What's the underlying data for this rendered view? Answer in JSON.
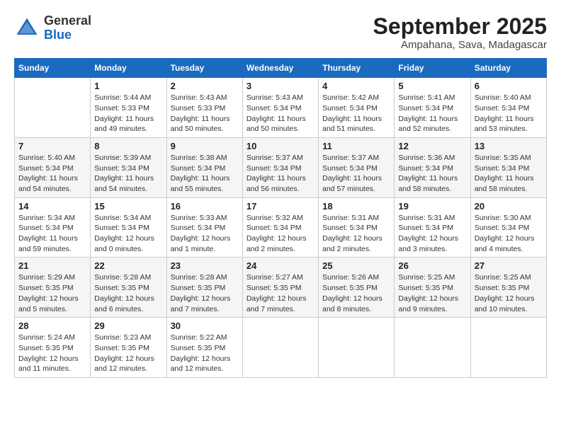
{
  "logo": {
    "general": "General",
    "blue": "Blue"
  },
  "title": "September 2025",
  "subtitle": "Ampahana, Sava, Madagascar",
  "days_of_week": [
    "Sunday",
    "Monday",
    "Tuesday",
    "Wednesday",
    "Thursday",
    "Friday",
    "Saturday"
  ],
  "weeks": [
    [
      {
        "day": "",
        "info": ""
      },
      {
        "day": "1",
        "info": "Sunrise: 5:44 AM\nSunset: 5:33 PM\nDaylight: 11 hours\nand 49 minutes."
      },
      {
        "day": "2",
        "info": "Sunrise: 5:43 AM\nSunset: 5:33 PM\nDaylight: 11 hours\nand 50 minutes."
      },
      {
        "day": "3",
        "info": "Sunrise: 5:43 AM\nSunset: 5:34 PM\nDaylight: 11 hours\nand 50 minutes."
      },
      {
        "day": "4",
        "info": "Sunrise: 5:42 AM\nSunset: 5:34 PM\nDaylight: 11 hours\nand 51 minutes."
      },
      {
        "day": "5",
        "info": "Sunrise: 5:41 AM\nSunset: 5:34 PM\nDaylight: 11 hours\nand 52 minutes."
      },
      {
        "day": "6",
        "info": "Sunrise: 5:40 AM\nSunset: 5:34 PM\nDaylight: 11 hours\nand 53 minutes."
      }
    ],
    [
      {
        "day": "7",
        "info": "Sunrise: 5:40 AM\nSunset: 5:34 PM\nDaylight: 11 hours\nand 54 minutes."
      },
      {
        "day": "8",
        "info": "Sunrise: 5:39 AM\nSunset: 5:34 PM\nDaylight: 11 hours\nand 54 minutes."
      },
      {
        "day": "9",
        "info": "Sunrise: 5:38 AM\nSunset: 5:34 PM\nDaylight: 11 hours\nand 55 minutes."
      },
      {
        "day": "10",
        "info": "Sunrise: 5:37 AM\nSunset: 5:34 PM\nDaylight: 11 hours\nand 56 minutes."
      },
      {
        "day": "11",
        "info": "Sunrise: 5:37 AM\nSunset: 5:34 PM\nDaylight: 11 hours\nand 57 minutes."
      },
      {
        "day": "12",
        "info": "Sunrise: 5:36 AM\nSunset: 5:34 PM\nDaylight: 11 hours\nand 58 minutes."
      },
      {
        "day": "13",
        "info": "Sunrise: 5:35 AM\nSunset: 5:34 PM\nDaylight: 11 hours\nand 58 minutes."
      }
    ],
    [
      {
        "day": "14",
        "info": "Sunrise: 5:34 AM\nSunset: 5:34 PM\nDaylight: 11 hours\nand 59 minutes."
      },
      {
        "day": "15",
        "info": "Sunrise: 5:34 AM\nSunset: 5:34 PM\nDaylight: 12 hours\nand 0 minutes."
      },
      {
        "day": "16",
        "info": "Sunrise: 5:33 AM\nSunset: 5:34 PM\nDaylight: 12 hours\nand 1 minute."
      },
      {
        "day": "17",
        "info": "Sunrise: 5:32 AM\nSunset: 5:34 PM\nDaylight: 12 hours\nand 2 minutes."
      },
      {
        "day": "18",
        "info": "Sunrise: 5:31 AM\nSunset: 5:34 PM\nDaylight: 12 hours\nand 2 minutes."
      },
      {
        "day": "19",
        "info": "Sunrise: 5:31 AM\nSunset: 5:34 PM\nDaylight: 12 hours\nand 3 minutes."
      },
      {
        "day": "20",
        "info": "Sunrise: 5:30 AM\nSunset: 5:34 PM\nDaylight: 12 hours\nand 4 minutes."
      }
    ],
    [
      {
        "day": "21",
        "info": "Sunrise: 5:29 AM\nSunset: 5:35 PM\nDaylight: 12 hours\nand 5 minutes."
      },
      {
        "day": "22",
        "info": "Sunrise: 5:28 AM\nSunset: 5:35 PM\nDaylight: 12 hours\nand 6 minutes."
      },
      {
        "day": "23",
        "info": "Sunrise: 5:28 AM\nSunset: 5:35 PM\nDaylight: 12 hours\nand 7 minutes."
      },
      {
        "day": "24",
        "info": "Sunrise: 5:27 AM\nSunset: 5:35 PM\nDaylight: 12 hours\nand 7 minutes."
      },
      {
        "day": "25",
        "info": "Sunrise: 5:26 AM\nSunset: 5:35 PM\nDaylight: 12 hours\nand 8 minutes."
      },
      {
        "day": "26",
        "info": "Sunrise: 5:25 AM\nSunset: 5:35 PM\nDaylight: 12 hours\nand 9 minutes."
      },
      {
        "day": "27",
        "info": "Sunrise: 5:25 AM\nSunset: 5:35 PM\nDaylight: 12 hours\nand 10 minutes."
      }
    ],
    [
      {
        "day": "28",
        "info": "Sunrise: 5:24 AM\nSunset: 5:35 PM\nDaylight: 12 hours\nand 11 minutes."
      },
      {
        "day": "29",
        "info": "Sunrise: 5:23 AM\nSunset: 5:35 PM\nDaylight: 12 hours\nand 12 minutes."
      },
      {
        "day": "30",
        "info": "Sunrise: 5:22 AM\nSunset: 5:35 PM\nDaylight: 12 hours\nand 12 minutes."
      },
      {
        "day": "",
        "info": ""
      },
      {
        "day": "",
        "info": ""
      },
      {
        "day": "",
        "info": ""
      },
      {
        "day": "",
        "info": ""
      }
    ]
  ]
}
